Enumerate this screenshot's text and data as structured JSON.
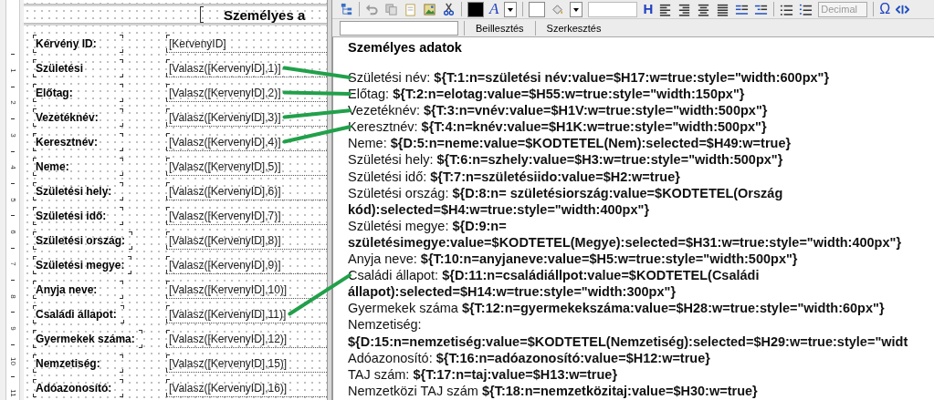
{
  "designer": {
    "title": "Személyes a",
    "ruler": [
      "1",
      "2",
      "3",
      "4",
      "5",
      "6",
      "7",
      "8",
      "9",
      "10",
      "11"
    ],
    "rows": [
      {
        "label": "Kérvény ID:",
        "field": "[KervenyID]",
        "linked": false
      },
      {
        "label": "Születési",
        "field": "[Valasz([KervenyID],1)]",
        "linked": true
      },
      {
        "label": "Előtag:",
        "field": "[Valasz([KervenyID],2)]",
        "linked": true
      },
      {
        "label": "Vezetéknév:",
        "field": "[Valasz([KervenyID],3)]",
        "linked": true
      },
      {
        "label": "Keresztnév:",
        "field": "[Valasz([KervenyID],4)]",
        "linked": true
      },
      {
        "label": "Neme:",
        "field": "[Valasz([KervenyID],5)]",
        "linked": false
      },
      {
        "label": "Születési hely:",
        "field": "[Valasz([KervenyID],6)]",
        "linked": false
      },
      {
        "label": "Születési idő:",
        "field": "[Valasz([KervenyID],7)]",
        "linked": false
      },
      {
        "label": "Születési ország:",
        "field": "[Valasz([KervenyID],8)]",
        "linked": false
      },
      {
        "label": "Születési megye:",
        "field": "[Valasz([KervenyID],9)]",
        "linked": false
      },
      {
        "label": "Anyja neve:",
        "field": "[Valasz([KervenyID],10)]",
        "linked": false
      },
      {
        "label": "Családi állapot:",
        "field": "[Valasz([KervenyID],11)]",
        "linked": true
      },
      {
        "label": "Gyermekek száma:",
        "field": "[Valasz([KervenyID],12)]",
        "linked": false
      },
      {
        "label": "Nemzetiség:",
        "field": "[Valasz([KervenyID],15)]",
        "linked": false
      },
      {
        "label": "Adóazonosító:",
        "field": "[Valasz([KervenyID],16)]",
        "linked": false
      }
    ]
  },
  "editor": {
    "toolbar": {
      "heading_glyph": "H",
      "font_color_glyph": "A",
      "symbol_glyph": "Ω",
      "list_style": {
        "value": "Decimal",
        "disabled": true
      }
    },
    "actions": [
      "Beillesztés",
      "Szerkesztés"
    ],
    "heading": "Személyes adatok",
    "lines": [
      {
        "label": "Születési név:",
        "code": "${T:1:n=születési név:value=$H17:w=true:style=\"width:600px\"}",
        "linked": true
      },
      {
        "label": "Előtag:",
        "code": "${T:2:n=elotag:value=$H55:w=true:style=\"width:150px\"}",
        "linked": true
      },
      {
        "label": "Vezetéknév:",
        "code": "${T:3:n=vnév:value=$H1V:w=true:style=\"width:500px\"}",
        "linked": true
      },
      {
        "label": "Keresztnév:",
        "code": "${T:4:n=knév:value=$H1K:w=true:style=\"width:500px\"}",
        "linked": true
      },
      {
        "label": "Neme:",
        "code": "${D:5:n=neme:value=$KODTETEL(Nem):selected=$H49:w=true}",
        "linked": false
      },
      {
        "label": "Születési hely:",
        "code": "${T:6:n=szhely:value=$H3:w=true:style=\"width:500px\"}",
        "linked": false
      },
      {
        "label": "Születési idő:",
        "code": "${T:7:n=születésiido:value=$H2:w=true}",
        "linked": false
      },
      {
        "label": "Születési ország:",
        "code": "${D:8:n= születésiország:value=$KODTETEL(Ország kód):selected=$H4:w=true:style=\"width:400px\"}",
        "linked": false
      },
      {
        "label": "Születési megye:",
        "code": "${D:9:n= születésimegye:value=$KODTETEL(Megye):selected=$H31:w=true:style=\"width:400px\"}",
        "linked": false
      },
      {
        "label": "Anyja neve:",
        "code": "${T:10:n=anyjaneve:value=$H5:w=true:style=\"width:500px\"}",
        "linked": false
      },
      {
        "label": "Családi állapot:",
        "code": "${D:11:n=családiállpot:value=$KODTETEL(Családi állapot):selected=$H14:w=true:style=\"width:300px\"}",
        "linked": true
      },
      {
        "label": "Gyermekek száma",
        "code": "${T:12:n=gyermekekszáma:value=$H28:w=true:style=\"width:60px\"}",
        "linked": false
      },
      {
        "label": "Nemzetiség:",
        "code": "${D:15:n=nemzetiség:value=$KODTETEL(Nemzetiség):selected=$H29:w=true:style=\"widt",
        "linked": false
      },
      {
        "label": "Adóazonosító:",
        "code": "${T:16:n=adóazonosító:value=$H12:w=true}",
        "linked": false
      },
      {
        "label": "TAJ szám:",
        "code": "${T:17:n=taj:value=$H13:w=true}",
        "linked": false
      },
      {
        "label": "Nemzetközi TAJ szám",
        "code": "${T:18:n=nemzetközitaj:value=$H30:w=true}",
        "linked": false
      }
    ]
  }
}
